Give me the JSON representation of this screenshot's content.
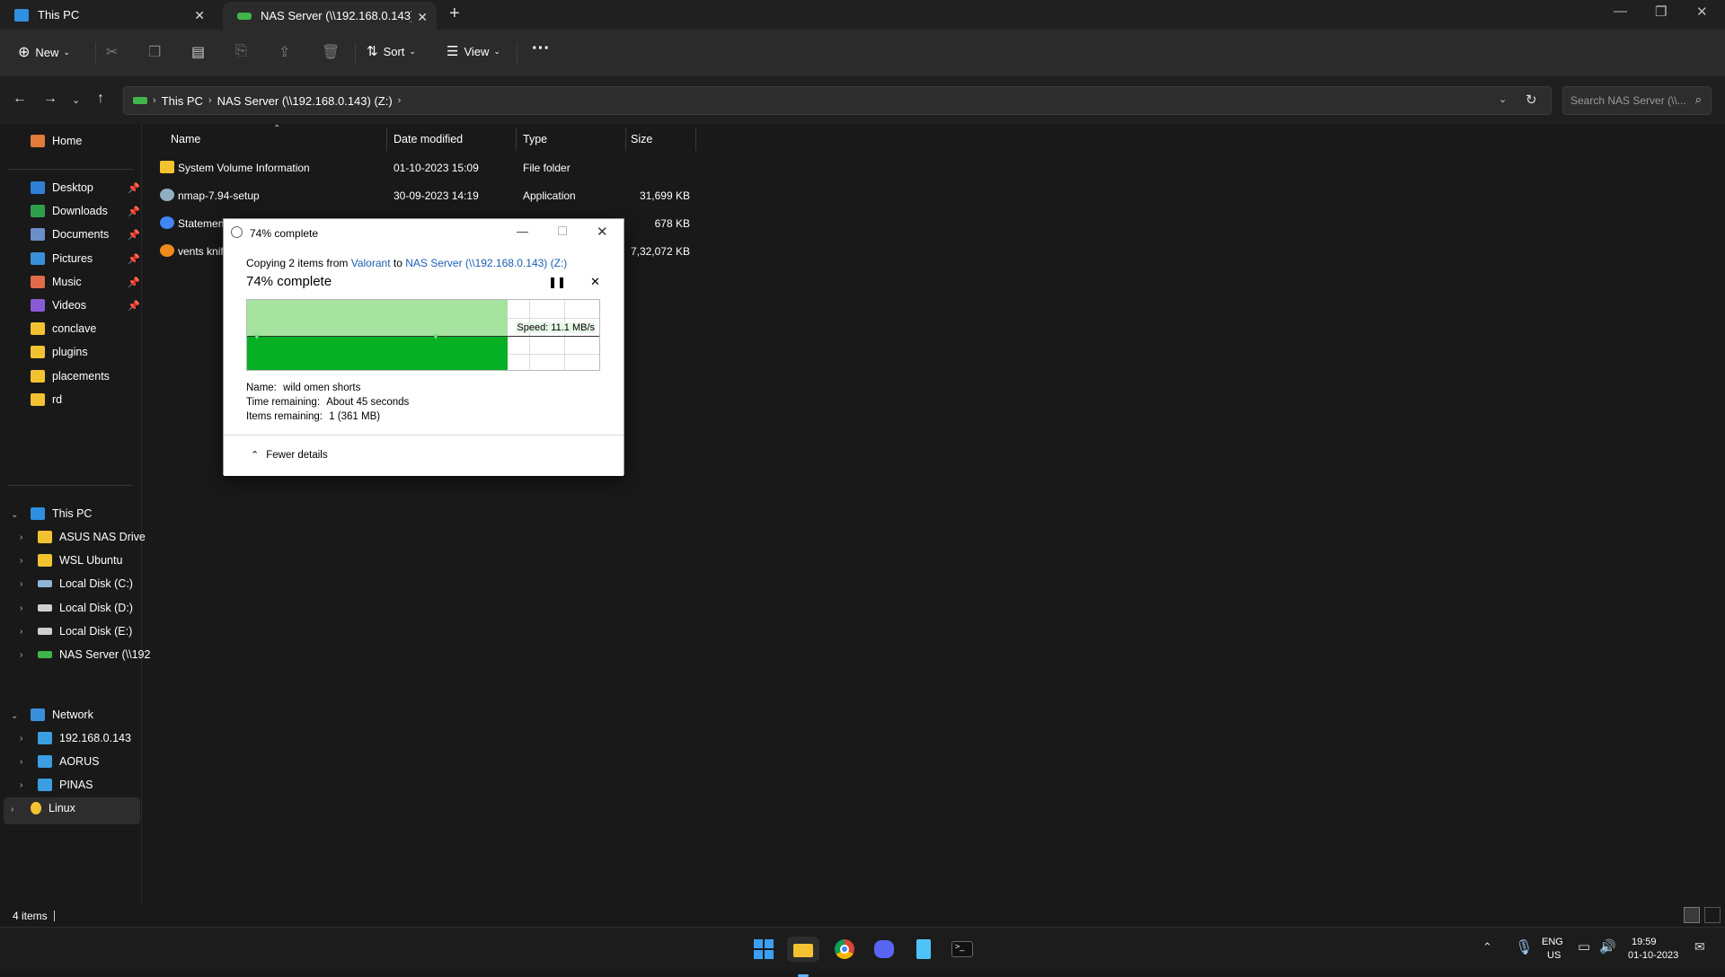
{
  "tabs": [
    {
      "label": "This PC",
      "active": false
    },
    {
      "label": "NAS Server (\\\\192.168.0.143) (Z:)",
      "active": true
    }
  ],
  "toolbar": {
    "new_label": "New",
    "sort_label": "Sort",
    "view_label": "View",
    "more_label": "···"
  },
  "address": {
    "crumbs": [
      "This PC",
      "NAS Server (\\\\192.168.0.143) (Z:)"
    ],
    "search_placeholder": "Search NAS Server (\\\\..."
  },
  "sidebar": {
    "home": "Home",
    "quick": [
      {
        "label": "Desktop",
        "pinned": true,
        "color": "#2f7fd6"
      },
      {
        "label": "Downloads",
        "pinned": true,
        "color": "#2f9e4a"
      },
      {
        "label": "Documents",
        "pinned": true,
        "color": "#6b8fc9"
      },
      {
        "label": "Pictures",
        "pinned": true,
        "color": "#3a8fd9"
      },
      {
        "label": "Music",
        "pinned": true,
        "color": "#e06a4a"
      },
      {
        "label": "Videos",
        "pinned": true,
        "color": "#8a5ad6"
      },
      {
        "label": "conclave",
        "pinned": false,
        "color": "#f2c230"
      },
      {
        "label": "plugins",
        "pinned": false,
        "color": "#f2c230"
      },
      {
        "label": "placements",
        "pinned": false,
        "color": "#f2c230"
      },
      {
        "label": "rd",
        "pinned": false,
        "color": "#f2c230"
      }
    ],
    "this_pc": "This PC",
    "drives": [
      {
        "label": "ASUS NAS Drive",
        "color": "#f2c230"
      },
      {
        "label": "WSL Ubuntu",
        "color": "#f2c230"
      },
      {
        "label": "Local Disk (C:)",
        "color": "#8fb6d8"
      },
      {
        "label": "Local Disk (D:)",
        "color": "#cfcfcf"
      },
      {
        "label": "Local Disk (E:)",
        "color": "#cfcfcf"
      },
      {
        "label": "NAS Server (\\\\192",
        "color": "#3fb54a"
      }
    ],
    "network": "Network",
    "network_items": [
      "192.168.0.143",
      "AORUS",
      "PINAS"
    ],
    "linux": "Linux"
  },
  "files": {
    "columns": [
      "Name",
      "Date modified",
      "Type",
      "Size"
    ],
    "rows": [
      {
        "name": "System Volume Information",
        "date": "01-10-2023 15:09",
        "type": "File folder",
        "size": ""
      },
      {
        "name": "nmap-7.94-setup",
        "date": "30-09-2023 14:19",
        "type": "Application",
        "size": "31,699 KB"
      },
      {
        "name": "Statemen",
        "date": "",
        "type": "",
        "size": "678 KB"
      },
      {
        "name": "vents knif",
        "date": "",
        "type": "",
        "size": "7,32,072 KB"
      }
    ]
  },
  "dialog": {
    "title": "74% complete",
    "copy_prefix": "Copying 2 items from ",
    "copy_source": "Valorant",
    "copy_mid": " to ",
    "copy_dest": "NAS Server (\\\\192.168.0.143) (Z:)",
    "percent_label": "74% complete",
    "progress": 0.74,
    "speed": "Speed: 11.1 MB/s",
    "name_label": "Name:",
    "name_value": "wild omen shorts",
    "time_label": "Time remaining:",
    "time_value": "About 45 seconds",
    "items_label": "Items remaining:",
    "items_value": "1 (361 MB)",
    "fewer_details": "Fewer details"
  },
  "status": {
    "items_count": "4 items"
  },
  "taskbar": {
    "lang_top": "ENG",
    "lang_bottom": "US",
    "time": "19:59",
    "date": "01-10-2023"
  }
}
